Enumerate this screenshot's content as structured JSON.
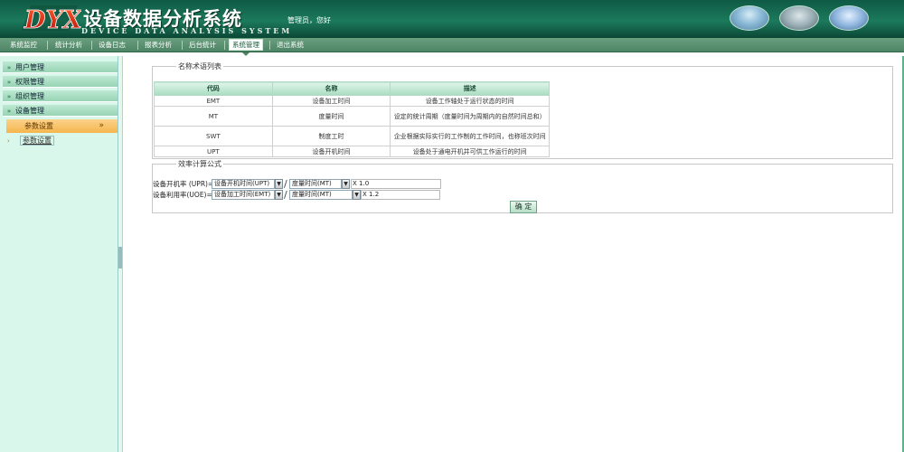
{
  "header": {
    "logo_text": "DYX",
    "title": "设备数据分析系统",
    "subtitle": "DEVICE DATA ANALYSIS SYSTEM",
    "greeting": "管理员，您好"
  },
  "nav": {
    "items": [
      "系统监控",
      "统计分析",
      "设备日志",
      "报表分析",
      "后台统计",
      "系统管理",
      "退出系统"
    ],
    "active_index": 5
  },
  "sidebar": {
    "items": [
      {
        "label": "用户管理",
        "icon": "double-chevron-right-icon"
      },
      {
        "label": "权限管理",
        "icon": "double-chevron-right-icon"
      },
      {
        "label": "组织管理",
        "icon": "double-chevron-right-icon"
      },
      {
        "label": "设备管理",
        "icon": "double-chevron-right-icon"
      }
    ],
    "expanded_group": {
      "label": "参数设置",
      "icon": "double-chevron-right-icon"
    },
    "leaf": {
      "label": "参数设置",
      "icon": "bullet-arrow-icon"
    }
  },
  "terms_section": {
    "legend": "名称术语列表",
    "headers": [
      "代码",
      "名称",
      "描述"
    ],
    "rows": [
      [
        "EMT",
        "设备加工时间",
        "设备工作轴处于运行状态的时间"
      ],
      [
        "MT",
        "度量时间",
        "设定的统计周期（度量时间为周期内的自然时间总和）"
      ],
      [
        "SWT",
        "制度工时",
        "企业根据实际实行的工作制的工作时间，也称班次时间"
      ],
      [
        "UPT",
        "设备开机时间",
        "设备处于通电开机并可供工作运行的时间"
      ]
    ]
  },
  "formula_section": {
    "legend": "效率计算公式",
    "rows": [
      {
        "label": "设备开机率 (UPR)=",
        "numerator": "设备开机时间(UPT)",
        "denominator": "度量时间(MT)",
        "factor": "X 1.0"
      },
      {
        "label": "设备利用率(UOE)=",
        "numerator": "设备加工时间(EMT)",
        "denominator": "度量时间(MT)",
        "factor": "X 1.2"
      }
    ],
    "confirm_label": "确 定"
  },
  "colors": {
    "header_green": "#1c7a5c",
    "nav_green": "#4d8566",
    "sidebar_bg": "#d9f7ea",
    "active_group_orange": "#f5b54e"
  }
}
